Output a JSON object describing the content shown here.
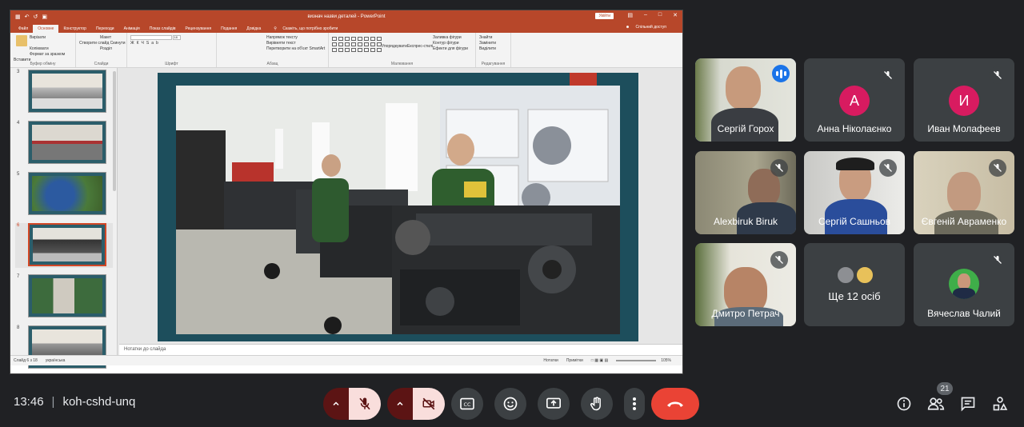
{
  "presentation": {
    "doc_title": "визнач назви деталей - PowerPoint",
    "sign_in": "Увійти",
    "tabs": [
      "Файл",
      "Основне",
      "Конструктор",
      "Переходи",
      "Анімація",
      "Показ слайдів",
      "Рецензування",
      "Подання",
      "Довідка"
    ],
    "active_tab": "Основне",
    "tell_me": "Скажіть, що потрібно зробити",
    "share": "Спільний доступ",
    "ribbon": {
      "paste": "Вставити",
      "cut": "Вирізати",
      "copy": "Копіювати",
      "format_painter": "Формат за зразком",
      "clipboard_group": "Буфер обміну",
      "new_slide": "Створити слайд",
      "layout": "Макет",
      "reset": "Скинути",
      "section": "Розділ",
      "slides_group": "Слайди",
      "font_group": "Шрифт",
      "text_direction": "Напрямок тексту",
      "align_text": "Вирівняти текст",
      "smartart": "Перетворити на об'єкт SmartArt",
      "paragraph_group": "Абзац",
      "arrange": "Упорядкувати",
      "quick_styles": "Експрес-стилі",
      "shape_fill": "Заливка фігури",
      "shape_outline": "Контур фігури",
      "shape_effects": "Ефекти для фігури",
      "drawing_group": "Малювання",
      "find": "Знайти",
      "replace": "Замінити",
      "select": "Виділити",
      "editing_group": "Редагування",
      "font_size": "18"
    },
    "thumbnails": [
      {
        "num": "3",
        "color": "#d9d6ce"
      },
      {
        "num": "4",
        "color": "#c9c5bc"
      },
      {
        "num": "5",
        "color": "#2f5f8f"
      },
      {
        "num": "6",
        "color": "#6d6f6c"
      },
      {
        "num": "7",
        "color": "#3d6b3d"
      },
      {
        "num": "8",
        "color": "#bdb8ae"
      }
    ],
    "selected_slide": "6",
    "notes_placeholder": "Нотатки до слайда",
    "status": {
      "slide_of": "Слайд 6 з 18",
      "language": "українська",
      "notes": "Нотатки",
      "comments": "Примітки",
      "zoom": "105%"
    }
  },
  "participants": [
    {
      "name": "Сергій Горох",
      "type": "video",
      "speaking": true,
      "muted": false
    },
    {
      "name": "Анна Ніколаєнко",
      "type": "avatar",
      "letter": "А",
      "avatar_color": "#d81b60",
      "muted": true
    },
    {
      "name": "Иван Молафеев",
      "type": "avatar",
      "letter": "И",
      "avatar_color": "#d81b60",
      "muted": true
    },
    {
      "name": "Alexbiruk Biruk",
      "type": "video",
      "muted": true
    },
    {
      "name": "Сергій Сашньов",
      "type": "video",
      "muted": true
    },
    {
      "name": "Євгеній Авраменко",
      "type": "video",
      "muted": true
    },
    {
      "name": "Дмитро Петрач",
      "type": "video",
      "muted": true
    },
    {
      "name": "Ще 12 осіб",
      "type": "more"
    },
    {
      "name": "Вячеслав Чалий",
      "type": "photo-avatar",
      "muted": true
    }
  ],
  "meeting": {
    "time": "13:46",
    "code": "koh-cshd-unq",
    "participant_count": "21"
  },
  "colors": {
    "background": "#202124",
    "tile": "#3c4043",
    "end_call": "#ea4335",
    "muted_btn": "#f9dedc",
    "active_outline": "#8ab4f8",
    "ppt_red": "#b7472a"
  }
}
